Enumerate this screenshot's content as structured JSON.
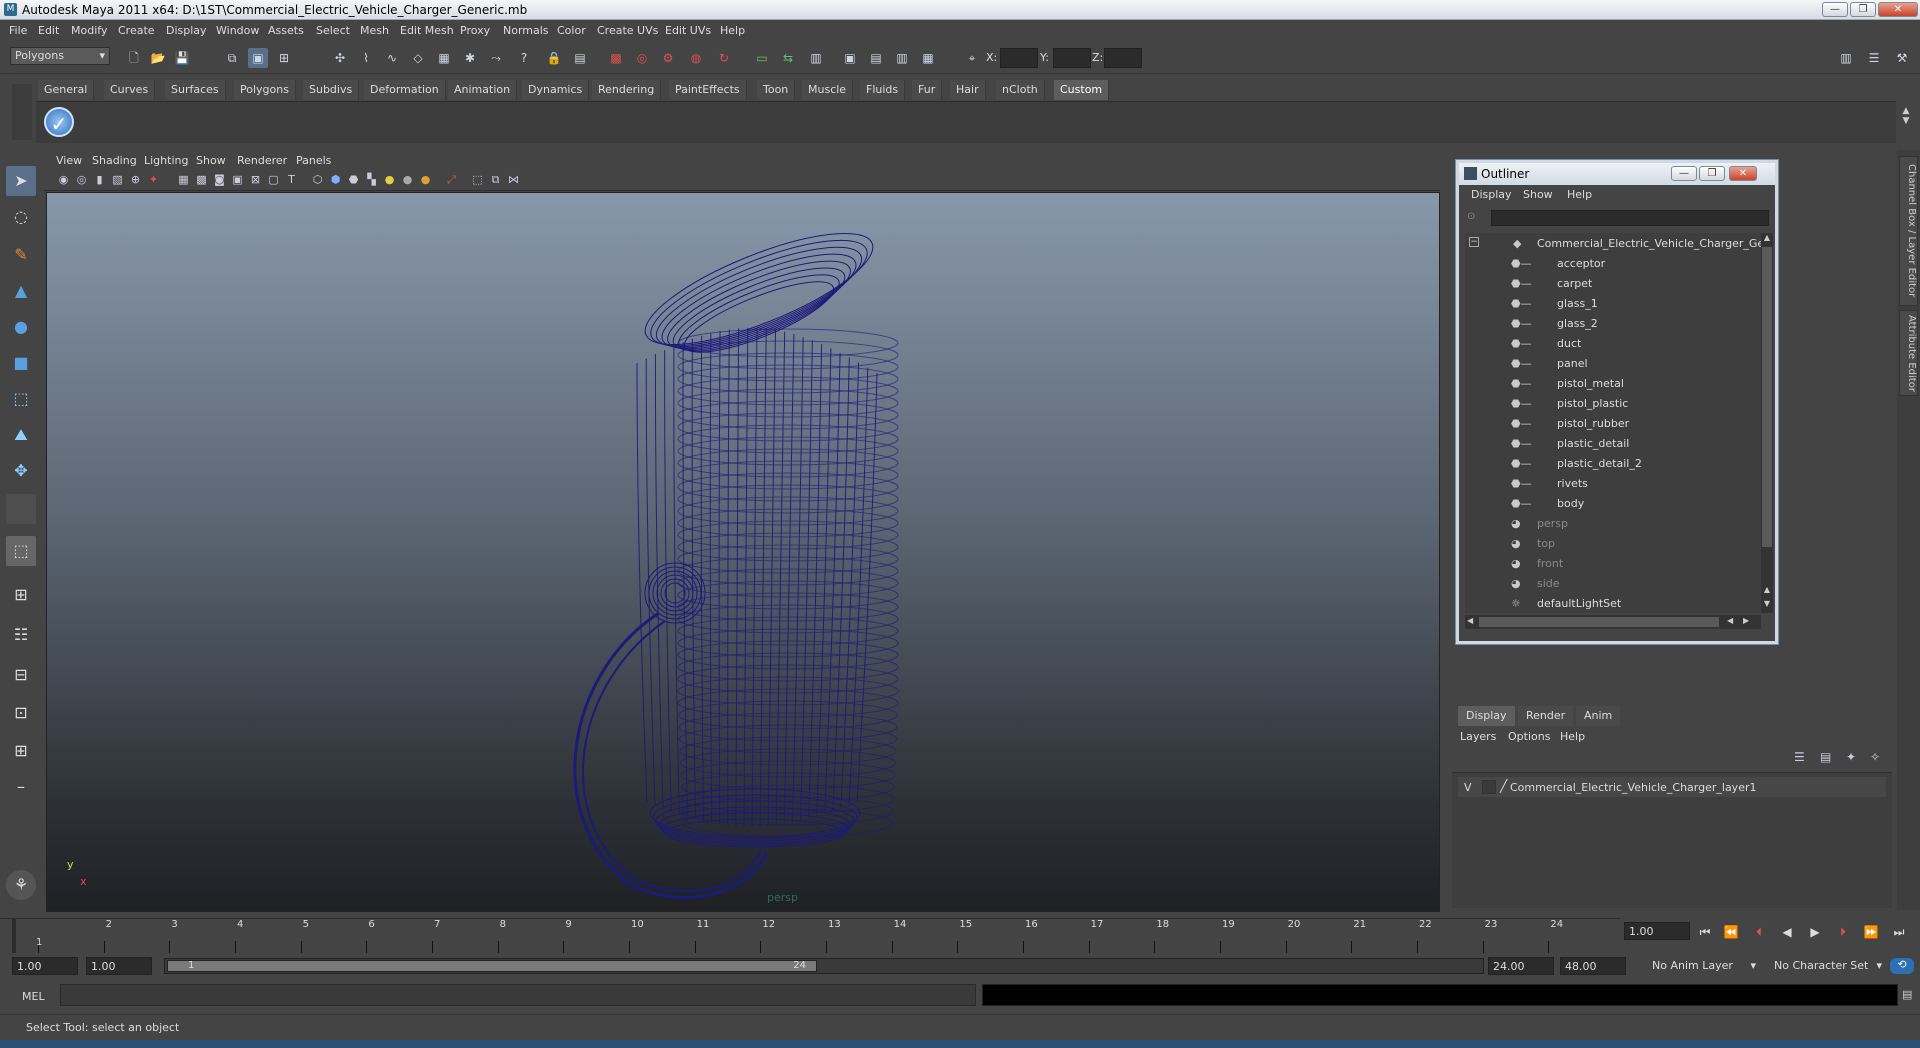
{
  "window": {
    "title": "Autodesk Maya 2011 x64: D:\\1ST\\Commercial_Electric_Vehicle_Charger_Generic.mb",
    "minimize": "—",
    "maximize": "❐",
    "close": "✕"
  },
  "menubar": [
    "File",
    "Edit",
    "Modify",
    "Create",
    "Display",
    "Window",
    "Assets",
    "Select",
    "Mesh",
    "Edit Mesh",
    "Proxy",
    "Normals",
    "Color",
    "Create UVs",
    "Edit UVs",
    "Help"
  ],
  "toolbar": {
    "mode": "Polygons",
    "x_label": "X:",
    "y_label": "Y:",
    "z_label": "Z:"
  },
  "shelf": {
    "tabs": [
      "General",
      "Curves",
      "Surfaces",
      "Polygons",
      "Subdivs",
      "Deformation",
      "Animation",
      "Dynamics",
      "Rendering",
      "PaintEffects",
      "Toon",
      "Muscle",
      "Fluids",
      "Fur",
      "Hair",
      "nCloth",
      "Custom"
    ],
    "active": "Custom"
  },
  "viewport": {
    "menus": [
      "View",
      "Shading",
      "Lighting",
      "Show",
      "Renderer",
      "Panels"
    ],
    "camera": "persp",
    "axis_y": "y",
    "axis_x": "x",
    "wire_color": "#1c1a7a"
  },
  "outliner": {
    "title": "Outliner",
    "menus": [
      "Display",
      "Show",
      "Help"
    ],
    "root": "Commercial_Electric_Vehicle_Charger_Generic",
    "children": [
      "acceptor",
      "carpet",
      "glass_1",
      "glass_2",
      "duct",
      "panel",
      "pistol_metal",
      "pistol_plastic",
      "pistol_rubber",
      "plastic_detail",
      "plastic_detail_2",
      "rivets",
      "body"
    ],
    "cameras": [
      "persp",
      "top",
      "front",
      "side"
    ],
    "sets": [
      "defaultLightSet"
    ]
  },
  "right_tabs": [
    "Channel Box / Layer Editor",
    "Attribute Editor"
  ],
  "layer_editor": {
    "tabs": [
      "Display",
      "Render",
      "Anim"
    ],
    "active": "Display",
    "menus": [
      "Layers",
      "Options",
      "Help"
    ],
    "layer_visible": "V",
    "layer_name": "Commercial_Electric_Vehicle_Charger_layer1"
  },
  "timeline": {
    "ticks": [
      "1",
      "2",
      "3",
      "4",
      "5",
      "6",
      "7",
      "8",
      "9",
      "10",
      "11",
      "12",
      "13",
      "14",
      "15",
      "16",
      "17",
      "18",
      "19",
      "20",
      "21",
      "22",
      "23",
      "24"
    ],
    "current_frame_label": "1",
    "current_time": "1.00"
  },
  "range": {
    "start_time": "1.00",
    "playback_start": "1.00",
    "thumb_start": "1",
    "thumb_end": "24",
    "playback_end": "24.00",
    "end_time": "48.00",
    "anim_layer": "No Anim Layer",
    "character_set": "No Character Set"
  },
  "mel": {
    "label": "MEL"
  },
  "help": {
    "text": "Select Tool: select an object"
  }
}
